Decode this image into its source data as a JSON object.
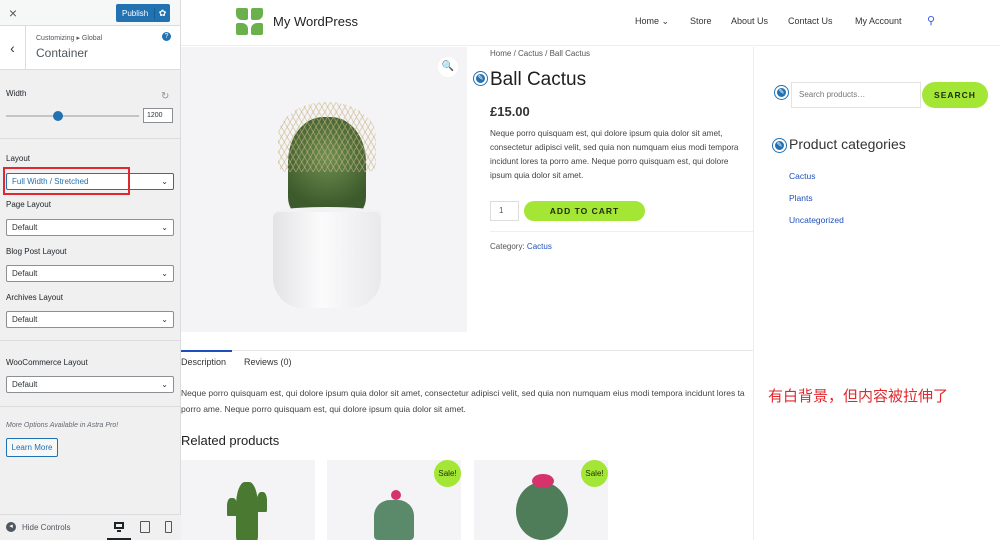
{
  "customizer": {
    "close_glyph": "×",
    "publish_label": "Publish",
    "gear_glyph": "✿",
    "back_glyph": "‹",
    "breadcrumb": "Customizing ▸ Global",
    "section_title": "Container",
    "help_glyph": "?",
    "width_label": "Width",
    "width_value": "1200",
    "reset_glyph": "↻",
    "layout_label": "Layout",
    "layout_value": "Full Width / Stretched",
    "page_layout_label": "Page Layout",
    "page_layout_value": "Default",
    "blog_layout_label": "Blog Post Layout",
    "blog_layout_value": "Default",
    "archives_layout_label": "Archives Layout",
    "archives_layout_value": "Default",
    "woo_layout_label": "WooCommerce Layout",
    "woo_layout_value": "Default",
    "pro_note": "More Options Available in Astra Pro!",
    "learn_more": "Learn More",
    "hide_controls": "Hide Controls",
    "hide_glyph": "◂"
  },
  "site": {
    "title": "My WordPress",
    "nav": [
      "Home ⌄",
      "Store",
      "About Us",
      "Contact Us",
      "My Account"
    ],
    "search_glyph": "⚲"
  },
  "product": {
    "zoom_glyph": "🔍",
    "breadcrumb": "Home / Cactus / Ball Cactus",
    "title": "Ball Cactus",
    "price": "£15.00",
    "description": "Neque porro quisquam est, qui dolore ipsum quia dolor sit amet, consectetur adipisci velit, sed quia non numquam eius modi tempora incidunt lores ta porro ame. Neque porro quisquam est, qui dolore ipsum quia dolor sit amet.",
    "qty": "1",
    "add_to_cart": "ADD TO CART",
    "category_label": "Category:",
    "category_value": "Cactus",
    "tabs": [
      "Description",
      "Reviews (0)"
    ],
    "long_description": "Neque porro quisquam est, qui dolore ipsum quia dolor sit amet, consectetur adipisci velit, sed quia non numquam eius modi tempora incidunt lores ta porro ame. Neque porro quisquam est, qui dolore ipsum quia dolor sit amet.",
    "related_heading": "Related products",
    "sale_badge": "Sale!"
  },
  "sidebar_widgets": {
    "search_placeholder": "Search products…",
    "search_button": "SEARCH",
    "categories_title": "Product categories",
    "categories": [
      "Cactus",
      "Plants",
      "Uncategorized"
    ]
  },
  "annotation": "有白背景，但内容被拉伸了",
  "edit_glyph": "✎",
  "colors": {
    "accent_green": "#a3e635",
    "link_blue": "#1e4fbf",
    "wp_blue": "#2271b1",
    "annotation_red": "#e0282e"
  }
}
